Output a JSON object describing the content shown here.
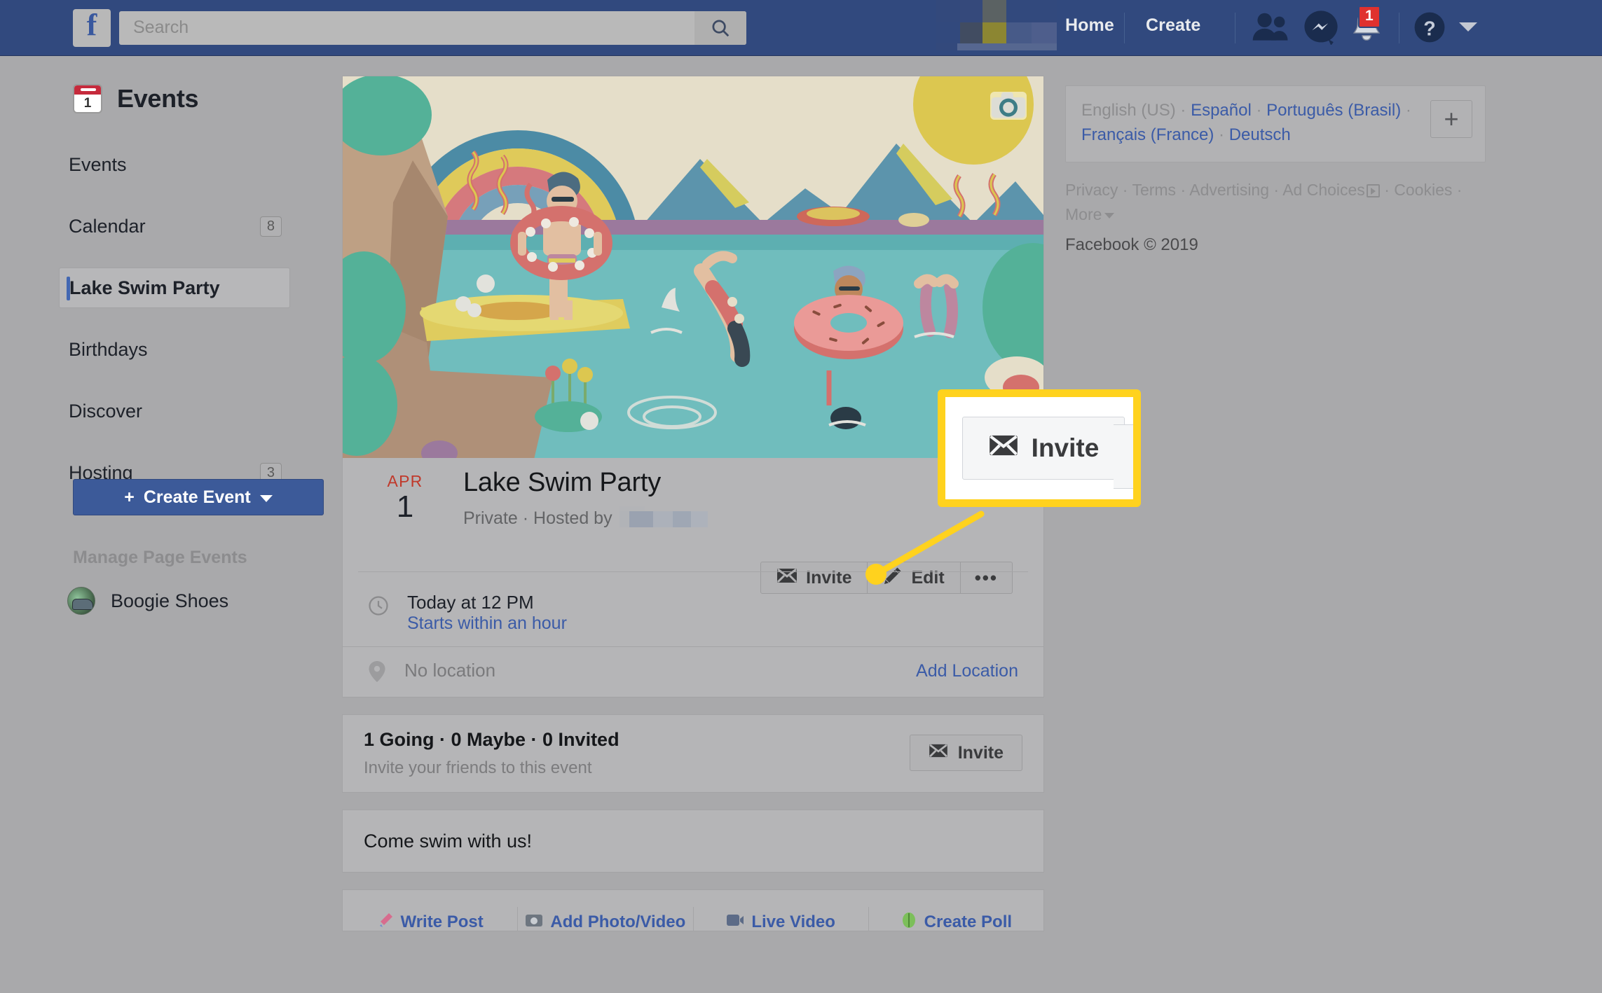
{
  "topbar": {
    "logo": "f",
    "search": {
      "placeholder": "Search",
      "value": "",
      "icon": "search-icon"
    },
    "home_label": "Home",
    "create_label": "Create",
    "icons": [
      "friend-requests-icon",
      "messenger-icon",
      "notifications-icon",
      "help-icon",
      "account-caret-icon"
    ],
    "notification_count": "1",
    "bg_color": "#31497E"
  },
  "sidebar": {
    "header": "Events",
    "header_icon": "calendar-icon",
    "calendar_day": "1",
    "items": [
      {
        "label": "Events",
        "count": "",
        "active": false
      },
      {
        "label": "Calendar",
        "count": "8",
        "active": false
      },
      {
        "label": "Lake Swim Party",
        "count": "",
        "active": true
      },
      {
        "label": "Birthdays",
        "count": "",
        "active": false
      },
      {
        "label": "Discover",
        "count": "",
        "active": false
      },
      {
        "label": "Hosting",
        "count": "3",
        "active": false
      }
    ],
    "create_event_label": "Create Event",
    "create_event_plus": "+",
    "manage_header": "Manage Page Events",
    "page_name": "Boogie Shoes"
  },
  "event": {
    "cover_camera_icon": "camera-icon",
    "date_month": "APR",
    "date_day": "1",
    "title": "Lake Swim Party",
    "privacy_host": "Private · Hosted by",
    "host_name_redacted": true,
    "buttons": {
      "invite": "Invite",
      "invite_icon": "envelope-icon",
      "edit": "Edit",
      "edit_icon": "pencil-icon",
      "more": "•••"
    },
    "time": {
      "icon": "clock-icon",
      "primary": "Today at 12 PM",
      "link": "Starts within an hour"
    },
    "location": {
      "icon": "map-pin-icon",
      "primary": "No location",
      "action": "Add Location"
    }
  },
  "rsvp": {
    "title": "1 Going · 0 Maybe · 0 Invited",
    "subtitle": "Invite your friends to this event",
    "invite_label": "Invite",
    "invite_icon": "envelope-icon"
  },
  "description": {
    "text": "Come swim with us!"
  },
  "composer": {
    "items": [
      {
        "label": "Write Post",
        "icon": "pen-icon"
      },
      {
        "label": "Add Photo/Video",
        "icon": "photo-icon"
      },
      {
        "label": "Live Video",
        "icon": "live-video-icon"
      },
      {
        "label": "Create Poll",
        "icon": "poll-icon"
      }
    ]
  },
  "rightcol": {
    "languages": [
      "English (US)",
      "Español",
      "Português (Brasil)",
      "Français (France)",
      "Deutsch"
    ],
    "current_language": "English (US)",
    "add_language_icon": "plus-icon",
    "legal_links": [
      "Privacy",
      "Terms",
      "Advertising",
      "Ad Choices",
      "Cookies",
      "More"
    ],
    "ad_choices_icon": "ad-choices-icon",
    "more_caret_icon": "caret-down-icon",
    "copyright": "Facebook © 2019"
  },
  "callout": {
    "button_label": "Invite",
    "button_icon": "envelope-icon",
    "border_color": "#FFD21E",
    "pointer_dot_color": "#FFD21E"
  }
}
